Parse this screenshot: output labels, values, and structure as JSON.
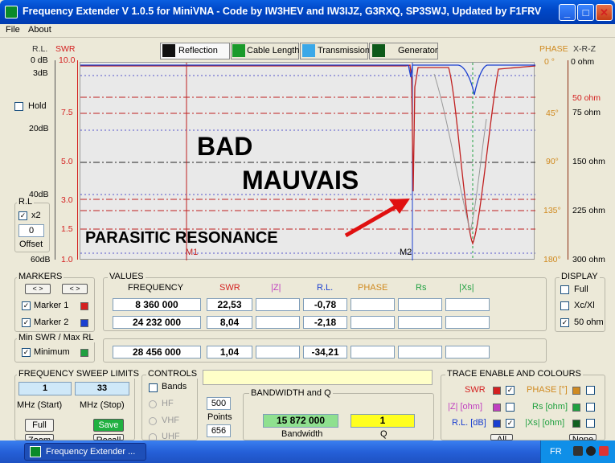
{
  "window": {
    "title": "Frequency Extender V 1.0.5  for MiniVNA  - Code by IW3HEV and IW3IJZ, G3RXQ, SP3SWJ, Updated by F1FRV"
  },
  "menu": [
    "File",
    "About"
  ],
  "tabs": [
    "Reflection",
    "Cable Length",
    "Transmission",
    "Generator"
  ],
  "left_axis": {
    "rl_header": "R.L.",
    "swr_header": "SWR",
    "rl_ticks": [
      "0 dB",
      "3dB",
      "20dB",
      "40dB",
      "60dB"
    ],
    "swr_ticks": [
      "10.0",
      "7.5",
      "5.0",
      "3.0",
      "1.5",
      "1.0"
    ]
  },
  "right_axis": {
    "phase_header": "PHASE",
    "xrz_header": "X-R-Z",
    "phase_ticks": [
      "0 °",
      "45°",
      "90°",
      "135°",
      "180°"
    ],
    "ohm_ticks": [
      "0 ohm",
      "50 ohm",
      "75 ohm",
      "150 ohm",
      "225 ohm",
      "300 ohm"
    ]
  },
  "hold_label": "Hold",
  "rl_group": {
    "title": "R.L",
    "x2_label": "x2",
    "offset_value": "0",
    "offset_label": "Offset"
  },
  "annotations": {
    "bad": "BAD",
    "mauvais": "MAUVAIS",
    "parasitic": "PARASITIC RESONANCE"
  },
  "markers_on_plot": [
    "M1",
    "M2"
  ],
  "markers": {
    "title": "MARKERS",
    "marker1": "Marker 1",
    "marker2": "Marker 2"
  },
  "min_swr": {
    "title": "Min SWR / Max RL",
    "label": "Minimum"
  },
  "values": {
    "title": "VALUES",
    "headers": [
      "FREQUENCY",
      "SWR",
      "|Z|",
      "R.L.",
      "PHASE",
      "Rs",
      "|Xs|"
    ],
    "rows": [
      {
        "freq": "8 360 000",
        "swr": "22,53",
        "rl": "-0,78"
      },
      {
        "freq": "24 232 000",
        "swr": "8,04",
        "rl": "-2,18"
      },
      {
        "freq": "28 456 000",
        "swr": "1,04",
        "rl": "-34,21"
      }
    ]
  },
  "display": {
    "title": "DISPLAY",
    "full": "Full",
    "xcxl": "Xc/Xl",
    "ohm": "50 ohm"
  },
  "sweep": {
    "title": "FREQUENCY SWEEP LIMITS",
    "start": "1",
    "stop": "33",
    "start_label": "MHz (Start)",
    "stop_label": "MHz (Stop)",
    "full_btn": "Full",
    "save_btn": "Save",
    "zoom_btn": "Zoom",
    "recall_btn": "Recall"
  },
  "controls": {
    "title": "CONTROLS",
    "bands": "Bands",
    "hf": "HF",
    "vhf": "VHF",
    "uhf": "UHF",
    "points_value": "500",
    "points_label": "Points",
    "second_value": "656"
  },
  "bandwidth": {
    "title": "BANDWIDTH and Q",
    "bw_value": "15 872 000",
    "q_value": "1",
    "bw_label": "Bandwidth",
    "q_label": "Q"
  },
  "trace": {
    "title": "TRACE ENABLE AND COLOURS",
    "swr": "SWR",
    "z": "|Z| [ohm]",
    "rl": "R.L. [dB]",
    "phase": "PHASE [°]",
    "rs": "Rs [ohm]",
    "xs": "|Xs| [ohm]",
    "all_btn": "All",
    "none_btn": "None"
  },
  "taskbar": {
    "task": "Frequency Extender ...",
    "lang": "FR"
  },
  "colors": {
    "swr": "#d42020",
    "marker2": "#1a3fd0",
    "rl_trace": "#1a3fd0",
    "phase_trace": "#8a8a8a"
  }
}
